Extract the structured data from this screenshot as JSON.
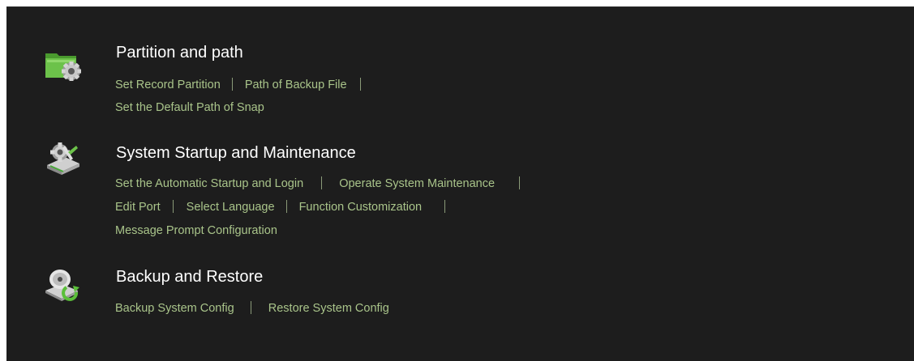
{
  "sections": [
    {
      "icon": "folder-gear-icon",
      "title": "Partition and path",
      "lines": [
        [
          "Set Record Partition",
          "Path of Backup File"
        ],
        [
          "Set the Default Path of Snap"
        ]
      ]
    },
    {
      "icon": "tools-drive-icon",
      "title": "System Startup and Maintenance",
      "lines": [
        [
          "Set the Automatic Startup and Login",
          "Operate System Maintenance"
        ],
        [
          "Edit Port",
          "Select Language",
          "Function Customization"
        ],
        [
          "Message Prompt Configuration"
        ]
      ]
    },
    {
      "icon": "disc-restore-icon",
      "title": "Backup and Restore",
      "lines": [
        [
          "Backup System Config",
          "Restore System Config"
        ]
      ]
    }
  ],
  "colors": {
    "background": "#1d1d1d",
    "title": "#ffffff",
    "link": "#a9c48a",
    "separator": "#8a9a78"
  }
}
